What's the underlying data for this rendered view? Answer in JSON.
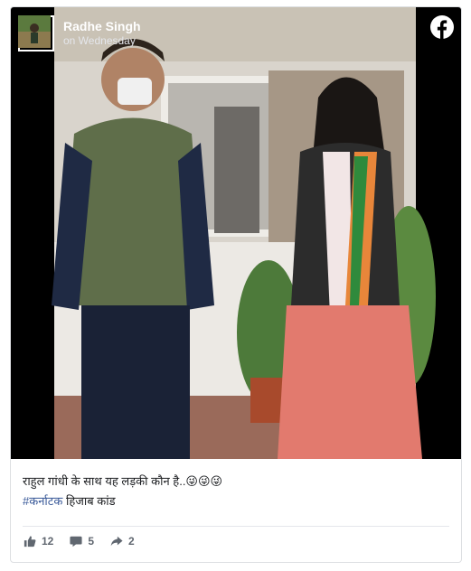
{
  "post": {
    "author": "Radhe Singh",
    "time": "on Wednesday",
    "caption_line1": "राहुल गांधी के साथ यह लड़की कौन है..😜😜😜",
    "hashtag": "#कर्नाटक",
    "caption_tail": " हिजाब कांड"
  },
  "stats": {
    "likes": "12",
    "comments": "5",
    "shares": "2"
  },
  "icons": [
    "facebook-logo-icon",
    "thumbs-up-icon",
    "comment-icon",
    "share-icon"
  ],
  "colors": {
    "link": "#385898",
    "muted": "#606770",
    "border": "#dddfe2"
  }
}
